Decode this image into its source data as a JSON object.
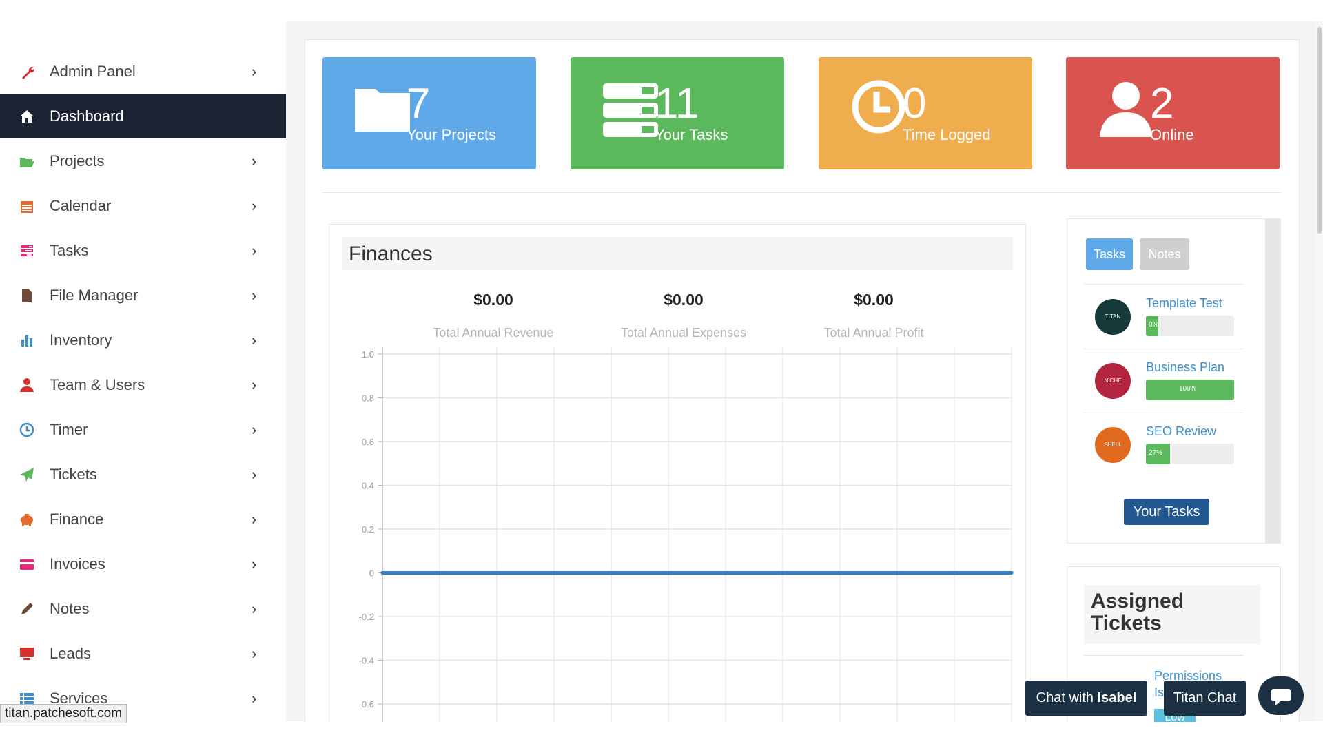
{
  "sidebar": {
    "items": [
      {
        "label": "Admin Panel",
        "icon": "wrench-icon",
        "color": "#d9302c"
      },
      {
        "label": "Dashboard",
        "icon": "home-icon",
        "color": "#ffffff",
        "active": true
      },
      {
        "label": "Projects",
        "icon": "folder-open-icon",
        "color": "#5cb85c"
      },
      {
        "label": "Calendar",
        "icon": "calendar-icon",
        "color": "#e46a2e"
      },
      {
        "label": "Tasks",
        "icon": "tasks-icon",
        "color": "#e8287a"
      },
      {
        "label": "File Manager",
        "icon": "file-icon",
        "color": "#6b4a3a"
      },
      {
        "label": "Inventory",
        "icon": "bar-chart-icon",
        "color": "#3b8fcd"
      },
      {
        "label": "Team & Users",
        "icon": "user-icon",
        "color": "#d9302c"
      },
      {
        "label": "Timer",
        "icon": "clock-icon",
        "color": "#3b8fcd"
      },
      {
        "label": "Tickets",
        "icon": "paper-plane-icon",
        "color": "#5cb85c"
      },
      {
        "label": "Finance",
        "icon": "piggy-bank-icon",
        "color": "#e46a2e"
      },
      {
        "label": "Invoices",
        "icon": "credit-card-icon",
        "color": "#e8287a"
      },
      {
        "label": "Notes",
        "icon": "pencil-icon",
        "color": "#6b4a3a"
      },
      {
        "label": "Leads",
        "icon": "desktop-icon",
        "color": "#d9302c"
      },
      {
        "label": "Services",
        "icon": "list-icon",
        "color": "#3b8fcd"
      }
    ]
  },
  "tiles": [
    {
      "value": "7",
      "caption": "Your Projects",
      "color": "#5fa9e8",
      "icon": "folder-icon"
    },
    {
      "value": "11",
      "caption": "Your Tasks",
      "color": "#5cb85c",
      "icon": "server-icon"
    },
    {
      "value": "0",
      "caption": "Time Logged",
      "color": "#f0ad4e",
      "icon": "clock-icon"
    },
    {
      "value": "2",
      "caption": "Online",
      "color": "#d9534f",
      "icon": "user-icon"
    }
  ],
  "finances": {
    "title": "Finances",
    "stats": [
      {
        "value": "$0.00",
        "label": "Total Annual Revenue"
      },
      {
        "value": "$0.00",
        "label": "Total Annual Expenses"
      },
      {
        "value": "$0.00",
        "label": "Total Annual Profit"
      }
    ]
  },
  "chart_data": {
    "type": "line",
    "title": "",
    "xlabel": "",
    "ylabel": "",
    "yticks": [
      "1.0",
      "0.8",
      "0.6",
      "0.4",
      "0.2",
      "0",
      "-0.2",
      "-0.4",
      "-0.6"
    ],
    "ylim": [
      -0.6,
      1.0
    ],
    "x": [
      0,
      1,
      2,
      3,
      4,
      5,
      6,
      7,
      8,
      9,
      10,
      11
    ],
    "series": [
      {
        "values": [
          0,
          0,
          0,
          0,
          0,
          0,
          0,
          0,
          0,
          0,
          0,
          0
        ],
        "color": "#2f7ec7"
      }
    ],
    "grid": true
  },
  "tasks_panel": {
    "tabs": [
      {
        "label": "Tasks",
        "color": "#5fa9e8"
      },
      {
        "label": "Notes",
        "color": "#cfcfcf"
      }
    ],
    "items": [
      {
        "name": "Template Test",
        "avatar": "TITAN",
        "avatar_color": "#163a3a",
        "progress": 0.14,
        "pct_label": "0%"
      },
      {
        "name": "Business Plan",
        "avatar": "NICHE",
        "avatar_color": "#b3243f",
        "progress": 1.0,
        "pct_label": "100%"
      },
      {
        "name": "SEO Review",
        "avatar": "SHELL",
        "avatar_color": "#e06a1f",
        "progress": 0.27,
        "pct_label": "27%"
      }
    ],
    "button": "Your Tasks"
  },
  "tickets_panel": {
    "title": "Assigned Tickets",
    "link": "Permissions Is",
    "badge": "Low"
  },
  "chat": {
    "prefix": "Chat with ",
    "name": "Isabel",
    "titan": "Titan Chat"
  },
  "status_url": "titan.patchesoft.com"
}
